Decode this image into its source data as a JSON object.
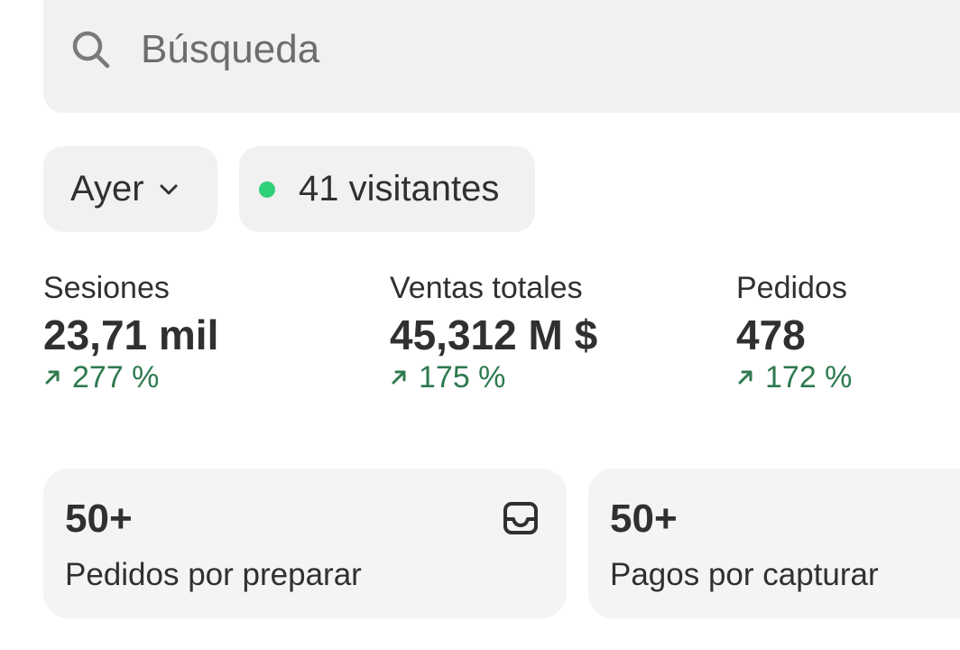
{
  "search": {
    "placeholder": "Búsqueda"
  },
  "filters": {
    "date_label": "Ayer",
    "visitors_label": "41 visitantes"
  },
  "metrics": [
    {
      "label": "Sesiones",
      "value": "23,71 mil",
      "delta": "277 %"
    },
    {
      "label": "Ventas totales",
      "value": "45,312 M $",
      "delta": "175 %"
    },
    {
      "label": "Pedidos",
      "value": "478",
      "delta": "172 %"
    }
  ],
  "cards": [
    {
      "count": "50+",
      "label": "Pedidos por preparar"
    },
    {
      "count": "50+",
      "label": "Pagos por capturar"
    }
  ],
  "colors": {
    "positive_delta": "#2f7a4f",
    "live_dot": "#2fd07a",
    "surface": "#f1f1f1"
  },
  "icons": {
    "search": "search-icon",
    "chevron": "chevron-down-icon",
    "trend": "arrow-up-right-icon",
    "inbox": "inbox-icon"
  }
}
